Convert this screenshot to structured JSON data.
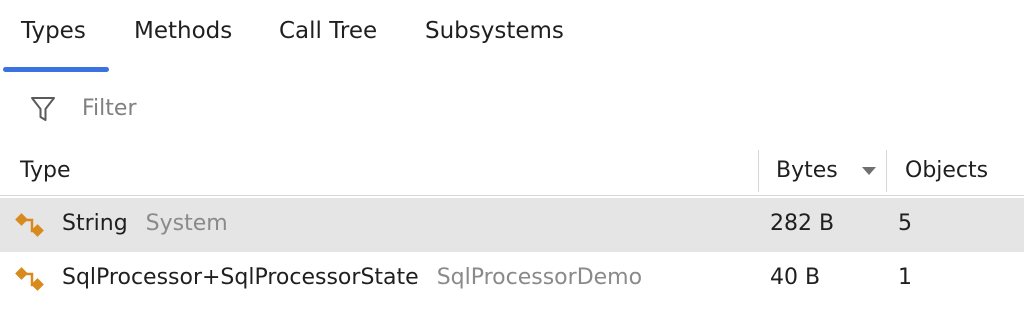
{
  "tabs": [
    {
      "label": "Types",
      "active": true
    },
    {
      "label": "Methods",
      "active": false
    },
    {
      "label": "Call Tree",
      "active": false
    },
    {
      "label": "Subsystems",
      "active": false
    }
  ],
  "filter": {
    "placeholder": "Filter",
    "value": "",
    "icon": "filter-icon"
  },
  "table": {
    "columns": [
      {
        "label": "Type"
      },
      {
        "label": "Bytes",
        "sorted": "descending"
      },
      {
        "label": "Objects"
      }
    ],
    "rows": [
      {
        "icon": "class-icon",
        "name": "String",
        "namespace": "System",
        "bytes": "282 B",
        "objects": "5",
        "selected": true
      },
      {
        "icon": "class-icon",
        "name": "SqlProcessor+SqlProcessorState",
        "namespace": "SqlProcessorDemo",
        "bytes": "40 B",
        "objects": "1",
        "selected": false
      }
    ]
  },
  "colors": {
    "accent": "#3a72e0",
    "type_icon": "#d98a1c",
    "selection": "#e5e5e5",
    "secondary_text": "#8a8a8a"
  }
}
